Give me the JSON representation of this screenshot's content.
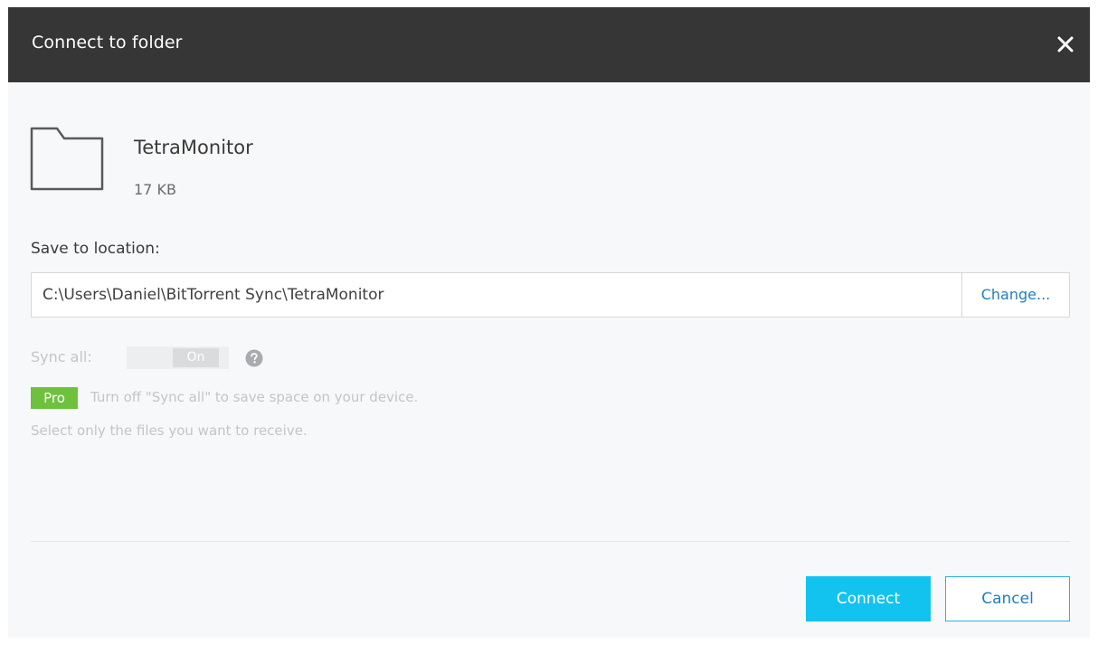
{
  "dialog": {
    "title": "Connect to folder",
    "close_icon": "close-icon"
  },
  "folder": {
    "icon": "folder-icon",
    "name": "TetraMonitor",
    "size": "17 KB"
  },
  "location": {
    "label": "Save to location:",
    "path": "C:\\Users\\Daniel\\BitTorrent Sync\\TetraMonitor",
    "change_label": "Change..."
  },
  "sync": {
    "label": "Sync all:",
    "toggle_state": "On",
    "help_icon": "help-icon",
    "enabled": false
  },
  "pro": {
    "badge": "Pro",
    "line1": "Turn off \"Sync all\" to save space on your device.",
    "line2": "Select only the files you want to receive."
  },
  "buttons": {
    "connect": "Connect",
    "cancel": "Cancel"
  },
  "colors": {
    "titlebar": "#363636",
    "accent": "#12c3f0",
    "link": "#1f7fbf",
    "pro_green": "#6dc13c"
  }
}
